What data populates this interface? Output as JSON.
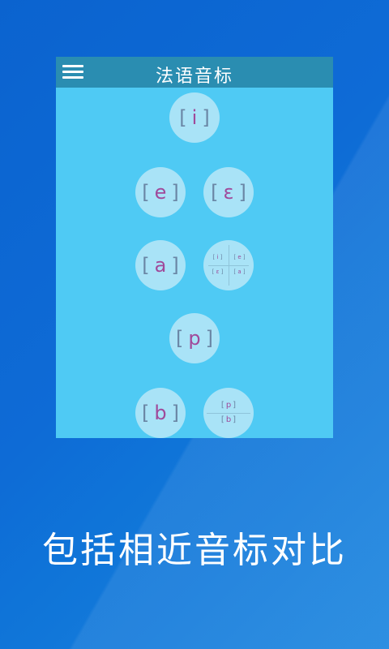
{
  "app": {
    "title": "法语音标"
  },
  "symbols": {
    "i": "i",
    "e": "e",
    "epsilon": "ɛ",
    "a": "a",
    "p": "p",
    "b": "b"
  },
  "compare_a": {
    "tl": "i",
    "tr": "e",
    "bl": "ɛ",
    "br": "a"
  },
  "compare_pb": {
    "top": "p",
    "bottom": "b"
  },
  "caption": "包括相近音标对比"
}
